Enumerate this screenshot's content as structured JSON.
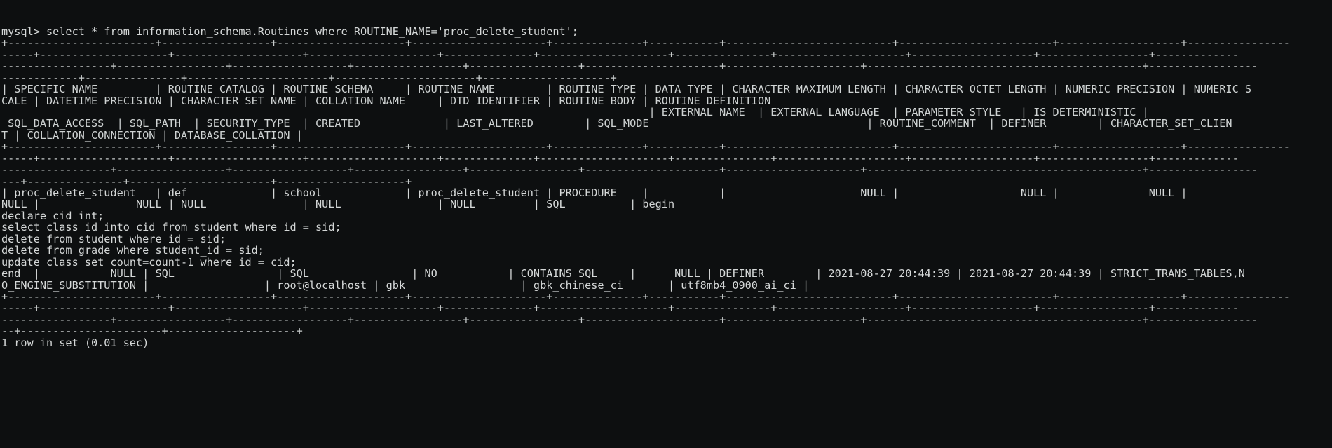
{
  "terminal": {
    "app": "mysql-client-terminal",
    "background_color": "#0d0f10",
    "foreground_color": "#d5d8d8",
    "prompt": "mysql>",
    "query": "mysql> select * from information_schema.Routines where ROUTINE_NAME='proc_delete_student';",
    "result_footer": "1 row in set (0.01 sec)",
    "row_count": 1,
    "elapsed": "0.01 sec"
  },
  "columns": [
    "SPECIFIC_NAME",
    "ROUTINE_CATALOG",
    "ROUTINE_SCHEMA",
    "ROUTINE_NAME",
    "ROUTINE_TYPE",
    "DATA_TYPE",
    "CHARACTER_MAXIMUM_LENGTH",
    "CHARACTER_OCTET_LENGTH",
    "NUMERIC_PRECISION",
    "NUMERIC_SCALE",
    "DATETIME_PRECISION",
    "CHARACTER_SET_NAME",
    "COLLATION_NAME",
    "DTD_IDENTIFIER",
    "ROUTINE_BODY",
    "ROUTINE_DEFINITION",
    "EXTERNAL_NAME",
    "EXTERNAL_LANGUAGE",
    "PARAMETER_STYLE",
    "IS_DETERMINISTIC",
    "SQL_DATA_ACCESS",
    "SQL_PATH",
    "SECURITY_TYPE",
    "CREATED",
    "LAST_ALTERED",
    "SQL_MODE",
    "ROUTINE_COMMENT",
    "DEFINER",
    "CHARACTER_SET_CLIENT",
    "COLLATION_CONNECTION",
    "DATABASE_COLLATION"
  ],
  "row": {
    "SPECIFIC_NAME": "proc_delete_student",
    "ROUTINE_CATALOG": "def",
    "ROUTINE_SCHEMA": "school",
    "ROUTINE_NAME": "proc_delete_student",
    "ROUTINE_TYPE": "PROCEDURE",
    "DATA_TYPE": "",
    "CHARACTER_MAXIMUM_LENGTH": "NULL",
    "CHARACTER_OCTET_LENGTH": "NULL",
    "NUMERIC_PRECISION": "NULL",
    "NUMERIC_SCALE": "NULL",
    "DATETIME_PRECISION": "NULL",
    "CHARACTER_SET_NAME": "NULL",
    "COLLATION_NAME": "NULL",
    "DTD_IDENTIFIER": "NULL",
    "ROUTINE_BODY": "SQL",
    "ROUTINE_DEFINITION_LINES": [
      "begin",
      "declare cid int;",
      "select class_id into cid from student where id = sid;",
      "delete from student where id = sid;",
      "delete from grade where student_id = sid;",
      "update class set count=count-1 where id = cid;",
      "end"
    ],
    "EXTERNAL_NAME": "NULL",
    "EXTERNAL_LANGUAGE": "SQL",
    "PARAMETER_STYLE": "SQL",
    "IS_DETERMINISTIC": "NO",
    "SQL_DATA_ACCESS": "CONTAINS SQL",
    "SQL_PATH": "NULL",
    "SECURITY_TYPE": "DEFINER",
    "CREATED": "2021-08-27 20:44:39",
    "LAST_ALTERED": "2021-08-27 20:44:39",
    "SQL_MODE": "STRICT_TRANS_TABLES,NO_ENGINE_SUBSTITUTION",
    "ROUTINE_COMMENT": "",
    "DEFINER": "root@localhost",
    "CHARACTER_SET_CLIENT": "gbk",
    "COLLATION_CONNECTION": "gbk_chinese_ci",
    "DATABASE_COLLATION": "utf8mb4_0900_ai_ci"
  },
  "lines": [
    {
      "kind": "prompt",
      "text": "mysql> select * from information_schema.Routines where ROUTINE_NAME='proc_delete_student';"
    },
    {
      "kind": "rule",
      "text": "+-----------------------+-----------------+--------------------+---------------------+--------------+-----------+--------------------------+------------------------+-------------------+----------------"
    },
    {
      "kind": "rule",
      "text": "-----+--------------------+--------------------+--------------------+--------------+--------------------+---------------+--------------------+-------------------+-----------------+-------------"
    },
    {
      "kind": "rule",
      "text": "-----------------+-----------------+------------------+-----------------+-----------------+---------------------+---------------------+-------------------------------------------+-----------------"
    },
    {
      "kind": "rule",
      "text": "------------+---------------+----------------------+----------------------+--------------------+"
    },
    {
      "kind": "header",
      "text": "| SPECIFIC_NAME         | ROUTINE_CATALOG | ROUTINE_SCHEMA     | ROUTINE_NAME        | ROUTINE_TYPE | DATA_TYPE | CHARACTER_MAXIMUM_LENGTH | CHARACTER_OCTET_LENGTH | NUMERIC_PRECISION | NUMERIC_S"
    },
    {
      "kind": "header",
      "text": "CALE | DATETIME_PRECISION | CHARACTER_SET_NAME | COLLATION_NAME     | DTD_IDENTIFIER | ROUTINE_BODY | ROUTINE_DEFINITION"
    },
    {
      "kind": "header",
      "text": "                                                                                                     | EXTERNAL_NAME  | EXTERNAL_LANGUAGE  | PARAMETER_STYLE   | IS_DETERMINISTIC |"
    },
    {
      "kind": "header",
      "text": " SQL_DATA_ACCESS  | SQL_PATH  | SECURITY_TYPE  | CREATED             | LAST_ALTERED        | SQL_MODE                                  | ROUTINE_COMMENT  | DEFINER        | CHARACTER_SET_CLIEN"
    },
    {
      "kind": "header",
      "text": "T | COLLATION_CONNECTION | DATABASE_COLLATION |"
    },
    {
      "kind": "rule",
      "text": "+-----------------------+-----------------+--------------------+---------------------+--------------+-----------+--------------------------+------------------------+-------------------+----------------"
    },
    {
      "kind": "rule",
      "text": "-----+--------------------+--------------------+--------------------+--------------+--------------------+---------------+--------------------+-------------------+-----------------+-------------"
    },
    {
      "kind": "rule",
      "text": "-----------------+-----------------+------------------+-----------------+-----------------+---------------------+---------------------+-------------------------------------------+-----------------"
    },
    {
      "kind": "rule",
      "text": "---+---------------+----------------------+--------------------+"
    },
    {
      "kind": "data",
      "text": "| proc_delete_student   | def             | school             | proc_delete_student | PROCEDURE    |           |                     NULL |                   NULL |              NULL |"
    },
    {
      "kind": "data",
      "text": "NULL |               NULL | NULL               | NULL               | NULL         | SQL          | begin"
    },
    {
      "kind": "data",
      "text": "declare cid int;"
    },
    {
      "kind": "data",
      "text": "select class_id into cid from student where id = sid;"
    },
    {
      "kind": "data",
      "text": "delete from student where id = sid;"
    },
    {
      "kind": "data",
      "text": "delete from grade where student_id = sid;"
    },
    {
      "kind": "data",
      "text": "update class set count=count-1 where id = cid;"
    },
    {
      "kind": "data",
      "text": "end  |           NULL | SQL                | SQL                | NO           | CONTAINS SQL     |      NULL | DEFINER        | 2021-08-27 20:44:39 | 2021-08-27 20:44:39 | STRICT_TRANS_TABLES,N"
    },
    {
      "kind": "data",
      "text": "O_ENGINE_SUBSTITUTION |                  | root@localhost | gbk                  | gbk_chinese_ci       | utf8mb4_0900_ai_ci |"
    },
    {
      "kind": "rule",
      "text": "+-----------------------+-----------------+--------------------+---------------------+--------------+-----------+--------------------------+------------------------+-------------------+----------------"
    },
    {
      "kind": "rule",
      "text": "-----+--------------------+--------------------+--------------------+--------------+--------------------+---------------+--------------------+-------------------+-----------------+-------------"
    },
    {
      "kind": "rule",
      "text": "-----------------+-----------------+------------------+-----------------+-----------------+---------------------+---------------------+-------------------------------------------+-----------------"
    },
    {
      "kind": "rule",
      "text": "--+----------------------+--------------------+"
    },
    {
      "kind": "footer",
      "text": "1 row in set (0.01 sec)"
    }
  ]
}
